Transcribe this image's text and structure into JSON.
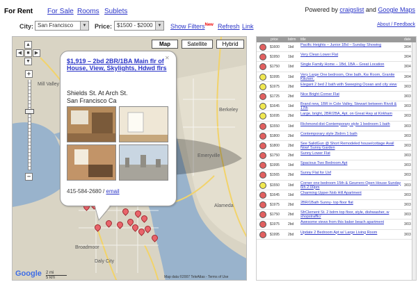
{
  "nav": {
    "tabs": [
      "For Rent",
      "For Sale",
      "Rooms",
      "Sublets"
    ],
    "powered_prefix": "Powered by",
    "powered_craigslist": "craigslist",
    "powered_and": "and",
    "powered_google": "Google Maps",
    "about": "About / Feedback"
  },
  "filters": {
    "city_label": "City:",
    "city_value": "San Francisco",
    "price_label": "Price:",
    "price_value": "$1500 - $2000",
    "show_filters": "Show Filters",
    "new_badge": "New",
    "refresh": "Refresh",
    "link": "Link"
  },
  "map": {
    "types": [
      "Map",
      "Satellite",
      "Hybrid"
    ],
    "active_type": "Map",
    "labels": [
      "Mill Valley",
      "Berkeley",
      "Emeryville",
      "Alameda",
      "Daly City",
      "Broadmoor"
    ],
    "scale_top": "2 mi",
    "scale_bottom": "5 km",
    "copyright": "Map data ©2007 TeleAtlas - Terms of Use",
    "logo": "Google",
    "colors": {
      "pin": "#e8646a",
      "water": "#99b3cc",
      "land": "#d9d4c4"
    }
  },
  "infowindow": {
    "title": "$1,919 – 2bd 2BR/1BA Main flr of House, View, Skylights, Hdwd flrs",
    "cross_street": "Shields St. At Arch St.",
    "city": "San Francisco Ca",
    "phone": "415-584-2680 /",
    "email": "email",
    "close_icon": "close-icon"
  },
  "listing": {
    "headers": [
      "",
      "price",
      "bdrm",
      "title",
      "date"
    ],
    "rows": [
      {
        "color": "#e26060",
        "price": "$1600",
        "br": "1bd",
        "title": "Pacific Heights – Junior 1Bd – Sunday Showing",
        "date": "3/04"
      },
      {
        "color": "#e26060",
        "price": "$1950",
        "br": "1bd",
        "title": "Very Clean Lower Flat",
        "date": "3/04"
      },
      {
        "color": "#e26060",
        "price": "$1750",
        "br": "1bd",
        "title": "Single Family Home – 1Bd, 1BA – Great Location",
        "date": "3/04"
      },
      {
        "color": "#f0e850",
        "price": "$1995",
        "br": "1bd",
        "title": "Very Large One bedroom, One bath, Kw Room, Granite Kitchen,",
        "date": "3/04"
      },
      {
        "color": "#f0e850",
        "price": "$1975",
        "br": "2bd",
        "title": "Elegant 2 bed 2 bath with Sweeping Ocean and city view",
        "date": "3/03"
      },
      {
        "color": "#e26060",
        "price": "$1725",
        "br": "2bd",
        "title": "Nice Bright Corner Flat",
        "date": "3/03"
      },
      {
        "color": "#f0e850",
        "price": "$1645",
        "br": "1bd",
        "title": "Brand new, 1BR in Cole Valley, Stewart between Rivoli & 17th",
        "date": "3/03"
      },
      {
        "color": "#f0e850",
        "price": "$1695",
        "br": "2bd",
        "title": "Large, bright, 2BR/2BA, Apt. on Great Hwy at Kirkham",
        "date": "3/03"
      },
      {
        "color": "#e26060",
        "price": "$1550",
        "br": "1bd",
        "title": "Richmond dist Contemporary style 1 bedroom 1 bath",
        "date": "3/03"
      },
      {
        "color": "#e26060",
        "price": "$1800",
        "br": "2bd",
        "title": "Contemporary style 2bdrm 1 bath",
        "date": "3/03"
      },
      {
        "color": "#e26060",
        "price": "$1800",
        "br": "2bd",
        "title": "See SalidGun @ Short Remodeled house/cottage Avail Now! Sunny Garden",
        "date": "3/03"
      },
      {
        "color": "#e26060",
        "price": "$1750",
        "br": "2bd",
        "title": "Sunny Lower Flat",
        "date": "3/03"
      },
      {
        "color": "#e26060",
        "price": "$1995",
        "br": "1bd",
        "title": "Spacious Two Bedroom Apt",
        "date": "3/03"
      },
      {
        "color": "#e26060",
        "price": "$1565",
        "br": "2bd",
        "title": "Sunny Flat for Usf",
        "date": "3/03"
      },
      {
        "color": "#f0e850",
        "price": "$1550",
        "br": "1bd",
        "title": "Corner one bedroom 15th & Geurrero Open House Sunday 6th 2:00pm",
        "date": "3/03"
      },
      {
        "color": "#e26060",
        "price": "$1645",
        "br": "1bd",
        "title": "Charming Upper Nob Hill Apartment",
        "date": "3/03"
      },
      {
        "color": "#e26060",
        "price": "$1975",
        "br": "2bd",
        "title": "2BR/1Bath Sunny- top floor flat",
        "date": "3/03"
      },
      {
        "color": "#e26060",
        "price": "$1750",
        "br": "2bd",
        "title": "SfrClement St. 2 bdrm top floor, style, dishwasher, w shopstraffic/",
        "date": "3/03"
      },
      {
        "color": "#e26060",
        "price": "$1975",
        "br": "2bd",
        "title": "Awesome views from this baker beach apartment",
        "date": "3/03"
      },
      {
        "color": "#e26060",
        "price": "$1995",
        "br": "2bd",
        "title": "Update 2 Bedroom Apt w/ Large Living Room",
        "date": "3/03"
      }
    ]
  }
}
